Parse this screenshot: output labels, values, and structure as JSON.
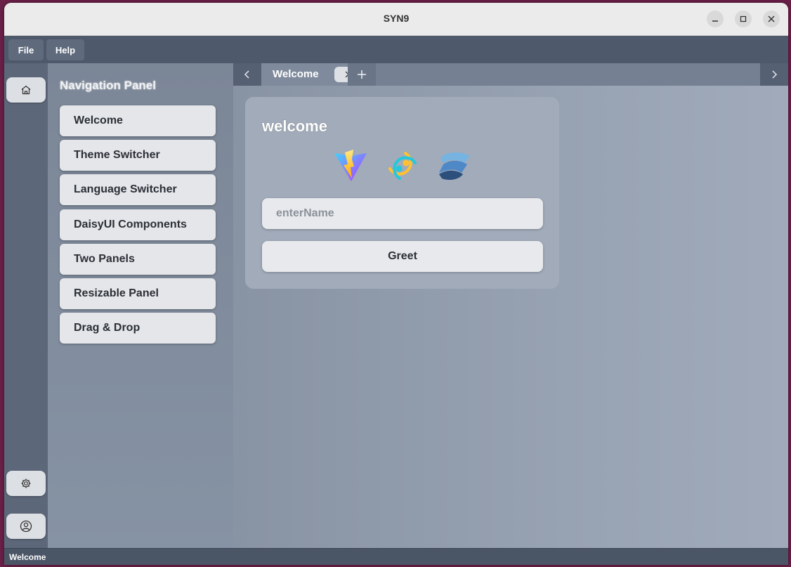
{
  "window": {
    "title": "SYN9"
  },
  "menubar": {
    "file": "File",
    "help": "Help"
  },
  "nav": {
    "title": "Navigation Panel",
    "items": [
      {
        "label": "Welcome"
      },
      {
        "label": "Theme Switcher"
      },
      {
        "label": "Language Switcher"
      },
      {
        "label": "DaisyUI Components"
      },
      {
        "label": "Two Panels"
      },
      {
        "label": "Resizable Panel"
      },
      {
        "label": "Drag & Drop"
      }
    ]
  },
  "tabs": [
    {
      "label": "Welcome",
      "active": true
    }
  ],
  "card": {
    "title": "welcome",
    "logos": [
      "vite-logo",
      "tauri-logo",
      "solid-logo"
    ],
    "input_placeholder": "enterName",
    "input_value": "",
    "greet_label": "Greet"
  },
  "status": {
    "text": "Welcome"
  },
  "icons": {
    "rail": [
      "home-icon",
      "settings-icon",
      "user-icon"
    ]
  },
  "colors": {
    "background": "#8a97a8",
    "menubar": "#4e5a6c",
    "rail": "#5c6779",
    "card": "#a1abba",
    "statusbar": "#4a5566"
  }
}
